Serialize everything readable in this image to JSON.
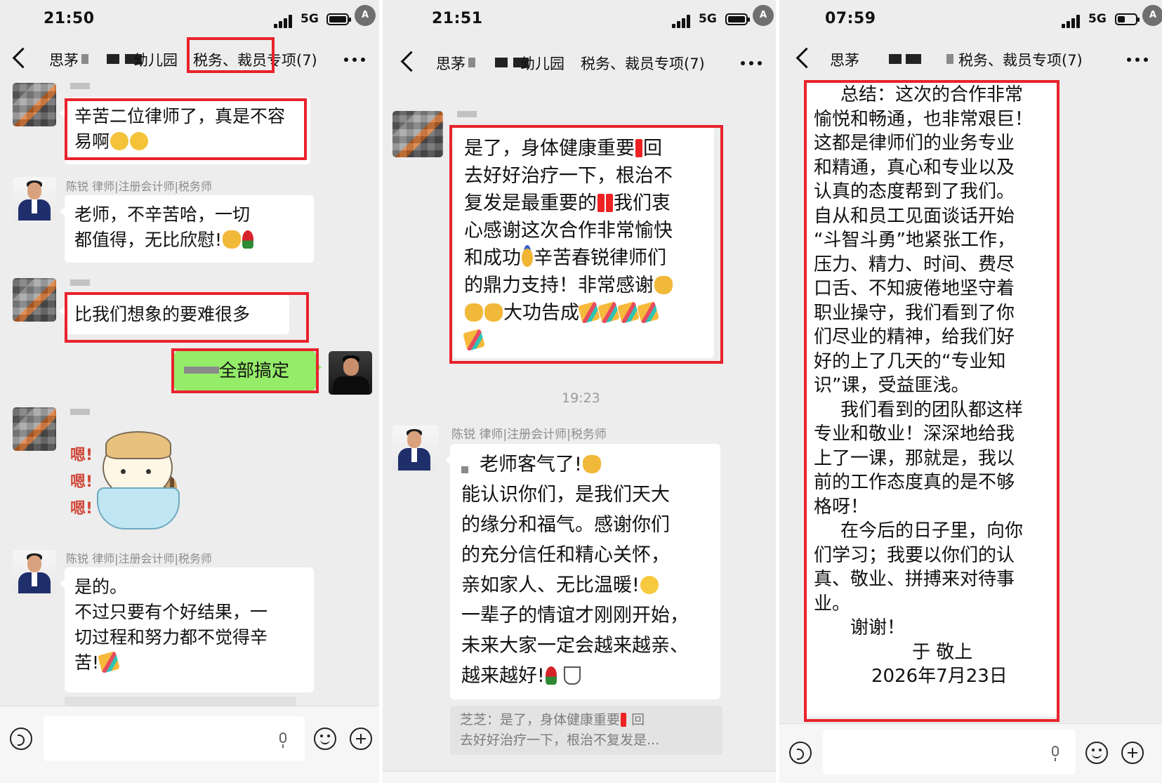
{
  "panels": [
    {
      "status": {
        "time": "21:50",
        "network": "5G",
        "translate_icon": "translate-icon"
      },
      "nav": {
        "contact": "思茅",
        "chat_title_a": "幼儿园",
        "chat_title_b": "税务、裁员专项(7)"
      },
      "messages": {
        "m1": {
          "sender": "",
          "text": "辛苦二位律师了，真是不容易啊"
        },
        "m2": {
          "sender": "陈锐 律师|注册会计师|税务师",
          "text_line1": "老师，不辛苦哈，一切",
          "text_line2": "都值得，无比欣慰!"
        },
        "m3": {
          "sender": "",
          "text": "比我们想象的要难很多"
        },
        "m4": {
          "text": "全部搞定"
        },
        "m5": {
          "sender": "",
          "sticker_text": [
            "嗯!",
            "嗯!",
            "嗯!"
          ]
        },
        "m6": {
          "sender": "陈锐 律师|注册会计师|税务师",
          "line1": "是的。",
          "line2": "不过只要有个好结果，一",
          "line3": "切过程和努力都不觉得辛",
          "line4": "苦!"
        }
      }
    },
    {
      "status": {
        "time": "21:51",
        "network": "5G",
        "translate_icon": "translate-icon"
      },
      "nav": {
        "contact": "思茅",
        "chat_title_a": "幼儿园",
        "chat_title_b": "税务、裁员专项(7)"
      },
      "messages": {
        "m1": {
          "line1": "是了，身体健康重要",
          "line1b": "回",
          "line2": "去好好治疗一下，根治不",
          "line3": "复发是最重要的",
          "line3b": "我们衷",
          "line4": "心感谢这次合作非常愉快",
          "line5": "和成功",
          "line5b": "辛苦春锐律师们",
          "line6": "的鼎力支持！非常感谢",
          "line7": "大功告成"
        },
        "timestamp": "19:23",
        "m2": {
          "sender": "陈锐 律师|注册会计师|税务师",
          "line1": "老师客气了!",
          "line2": "能认识你们，是我们天大",
          "line3": "的缘分和福气。感谢你们",
          "line4": "的充分信任和精心关怀，",
          "line5": "亲如家人、无比温暖!",
          "line6": "一辈子的情谊才刚刚开始，",
          "line7": "未来大家一定会越来越亲、",
          "line8": "越来越好!"
        },
        "quote": {
          "line1": "芝芝：是了，身体健康重要",
          "line1b": "回",
          "line2": "去好好治疗一下，根治不复发是..."
        }
      }
    },
    {
      "status": {
        "time": "07:59",
        "network": "5G",
        "translate_icon": "translate-icon"
      },
      "nav": {
        "contact": "思茅",
        "chat_title_b": "税务、裁员专项(7)"
      },
      "letter": {
        "p1": [
          "总结：这次的合作非常",
          "愉悦和畅通，也非常艰巨！",
          "这都是律师们的业务专业",
          "和精通，真心和专业以及",
          "认真的态度帮到了我们。",
          "自从和员工见面谈话开始",
          "“斗智斗勇”地紧张工作，",
          "压力、精力、时间、费尽",
          "口舌、不知疲倦地坚守着",
          "职业操守，我们看到了你",
          "们尽业的精神，给我们好",
          "好的上了几天的“专业知",
          "识”课，受益匪浅。"
        ],
        "p2": [
          "我们看到的团队都这样",
          "专业和敬业！深深地给我",
          "上了一课，那就是，我以",
          "前的工作态度真的是不够",
          "格呀！"
        ],
        "p3": [
          "在今后的日子里，向你",
          "们学习；我要以你们的认",
          "真、敬业、拼搏来对待事",
          "业。"
        ],
        "thanks": "谢谢！",
        "signature": "于    敬上",
        "date": "2026年7月23日"
      }
    }
  ]
}
